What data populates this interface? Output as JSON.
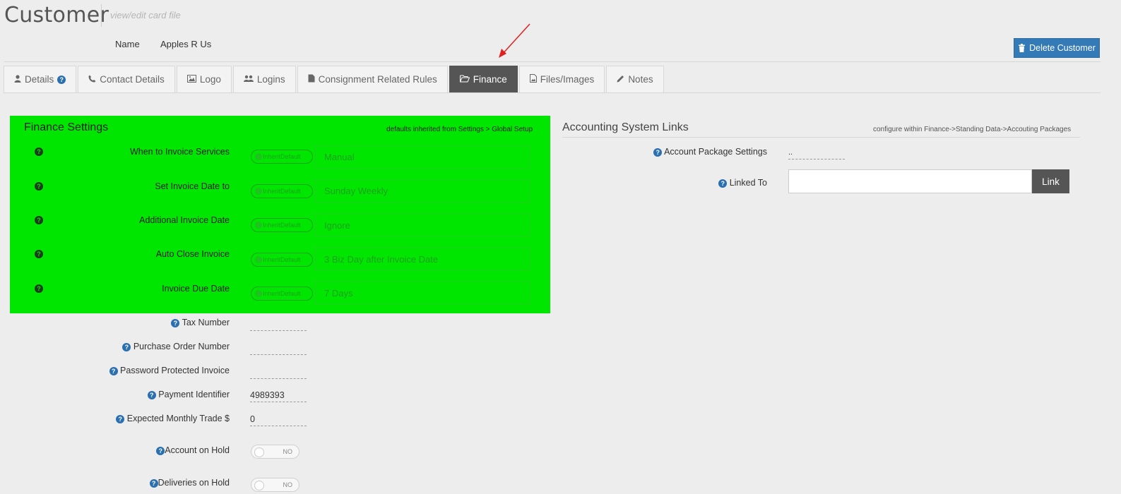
{
  "header": {
    "title": "Customer",
    "subtitle": "view/edit card file",
    "name_label": "Name",
    "name_value": "Apples R Us",
    "delete_label": "Delete Customer"
  },
  "tabs": [
    {
      "label": "Details",
      "icon": "user-icon"
    },
    {
      "label": "Contact Details",
      "icon": "phone-icon"
    },
    {
      "label": "Logo",
      "icon": "image-icon"
    },
    {
      "label": "Logins",
      "icon": "users-icon"
    },
    {
      "label": "Consignment Related Rules",
      "icon": "file-icon"
    },
    {
      "label": "Finance",
      "icon": "folder-open-icon",
      "active": true
    },
    {
      "label": "Files/Images",
      "icon": "file-image-icon"
    },
    {
      "label": "Notes",
      "icon": "pencil-icon"
    }
  ],
  "finance": {
    "title": "Finance Settings",
    "note": "defaults inherited from Settings > Global Setup",
    "inherit_label": "InheritDefault",
    "rows": [
      {
        "label": "When to Invoice Services",
        "value": "Manual"
      },
      {
        "label": "Set Invoice Date to",
        "value": "Sunday Weekly"
      },
      {
        "label": "Additional Invoice Date",
        "value": "Ignore"
      },
      {
        "label": "Auto Close Invoice",
        "value": "3 Biz Day after Invoice Date"
      },
      {
        "label": "Invoice Due Date",
        "value": "7 Days"
      }
    ],
    "highlight_color": "#00e600"
  },
  "fields": [
    {
      "label": "Tax Number",
      "value": ""
    },
    {
      "label": "Purchase Order Number",
      "value": ""
    },
    {
      "label": "Password Protected Invoice",
      "value": ""
    },
    {
      "label": "Payment Identifier",
      "value": "4989393"
    },
    {
      "label": "Expected Monthly Trade $",
      "value": "0"
    }
  ],
  "toggles": [
    {
      "label": "Account on Hold",
      "value": "NO"
    },
    {
      "label": "Deliveries on Hold",
      "value": "NO"
    }
  ],
  "accounting": {
    "title": "Accounting System Links",
    "note": "configure within Finance->Standing Data->Accouting Packages",
    "package_label": "Account Package Settings",
    "package_value": "..",
    "linked_label": "Linked To",
    "linked_value": "",
    "link_button": "Link"
  },
  "colors": {
    "primary": "#337ab7",
    "active_tab": "#555555",
    "annotation_arrow": "#e02020"
  }
}
